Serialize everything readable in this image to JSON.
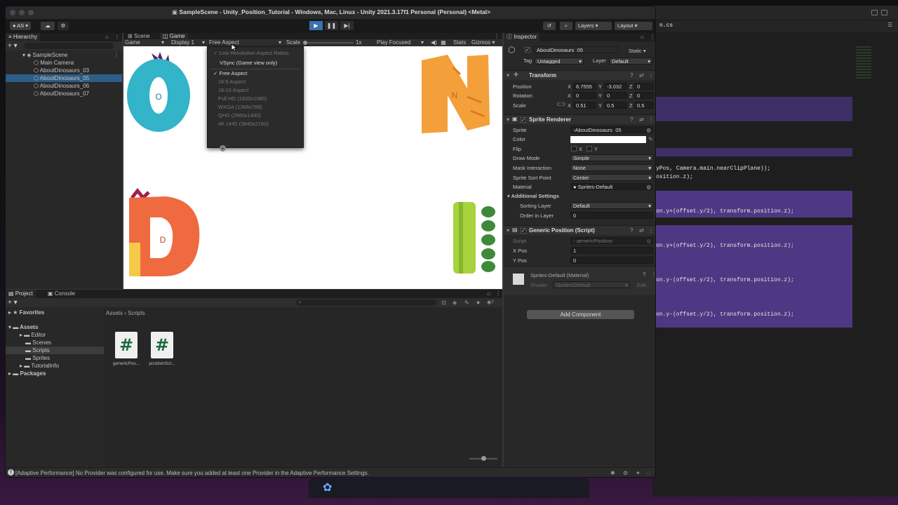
{
  "window_title": "SampleScene - Unity_Position_Tutorial - Windows, Mac, Linux - Unity 2021.3.17f1 Personal (Personal) <Metal>",
  "toolbar": {
    "account": "AS",
    "layers": "Layers",
    "layout": "Layout"
  },
  "hierarchy": {
    "tab": "Hierarchy",
    "scene": "SampleScene",
    "items": [
      "Main Camera",
      "AboutDinosaurs_03",
      "AboutDinosaurs_05",
      "AboutDinosaurs_06",
      "AboutDinosaurs_07"
    ],
    "selected_index": 2
  },
  "scene_tabs": {
    "scene": "Scene",
    "game": "Game"
  },
  "game_bar": {
    "mode": "Game",
    "display": "Display 1",
    "aspect": "Free Aspect",
    "scale_label": "Scale",
    "scale_value": "1x",
    "play_focused": "Play Focused",
    "stats": "Stats",
    "gizmos": "Gizmos"
  },
  "aspect_menu": {
    "low_res": "Low Resolution Aspect Ratios",
    "vsync": "VSync (Game view only)",
    "options": [
      "Free Aspect",
      "16:9 Aspect",
      "16:10 Aspect",
      "Full HD (1920x1080)",
      "WXGA (1366x768)",
      "QHD (2560x1440)",
      "4K UHD (3840x2160)"
    ],
    "checked_index": 0
  },
  "game_letters": [
    "O",
    "N",
    "D"
  ],
  "inspector": {
    "tab": "Inspector",
    "object_name": "AboutDinosaurs_05",
    "static": "Static",
    "tag_label": "Tag",
    "tag": "Untagged",
    "layer_label": "Layer",
    "layer": "Default",
    "transform": {
      "title": "Transform",
      "position_label": "Position",
      "position": {
        "x": "6.7555",
        "y": "-3.032",
        "z": "0"
      },
      "rotation_label": "Rotation",
      "rotation": {
        "x": "0",
        "y": "0",
        "z": "0"
      },
      "scale_label": "Scale",
      "scale": {
        "x": "0.51",
        "y": "0.5",
        "z": "0.5"
      }
    },
    "sprite_renderer": {
      "title": "Sprite Renderer",
      "sprite_label": "Sprite",
      "sprite": "AboutDinosaurs_05",
      "color_label": "Color",
      "flip_label": "Flip",
      "flip_x": "X",
      "flip_y": "Y",
      "draw_mode_label": "Draw Mode",
      "draw_mode": "Simple",
      "mask_label": "Mask Interaction",
      "mask": "None",
      "sort_point_label": "Sprite Sort Point",
      "sort_point": "Center",
      "material_label": "Material",
      "material": "Sprites-Default",
      "additional": "Additional Settings",
      "sorting_layer_label": "Sorting Layer",
      "sorting_layer": "Default",
      "order_label": "Order in Layer",
      "order": "0"
    },
    "generic_position": {
      "title": "Generic Position (Script)",
      "script_label": "Script",
      "script": "genericPosition",
      "xpos_label": "X Pos",
      "xpos": "1",
      "ypos_label": "Y Pos",
      "ypos": "0"
    },
    "material_block": {
      "title": "Sprites-Default (Material)",
      "shader_label": "Shader",
      "shader": "Sprites/Default",
      "edit": "Edit..."
    },
    "add_component": "Add Component"
  },
  "project": {
    "tabs": {
      "project": "Project",
      "console": "Console"
    },
    "favorites": "Favorites",
    "assets": "Assets",
    "folders": [
      "Editor",
      "Scenes",
      "Scripts",
      "Sprites",
      "TutorialInfo"
    ],
    "selected_folder_index": 2,
    "packages": "Packages",
    "breadcrumb": [
      "Assets",
      "Scripts"
    ],
    "count": "7",
    "files": [
      "genericPos...",
      "positionScr..."
    ]
  },
  "status_message": "[Adaptive Performance] No Provider was configured for use. Make sure you added at least one Provider in the Adaptive Performance Settings.",
  "code_editor": {
    "file_suffix": "n.cs",
    "lines": [
      "yPos, Camera.main.nearClipPlane));",
      "osition.z);",
      "on.y+(offset.y/2), transform.position.z);",
      "on.y+(offset.y/2), transform.position.z);",
      "on.y-(offset.y/2), transform.position.z);",
      "on.y-(offset.y/2), transform.position.z);"
    ]
  }
}
